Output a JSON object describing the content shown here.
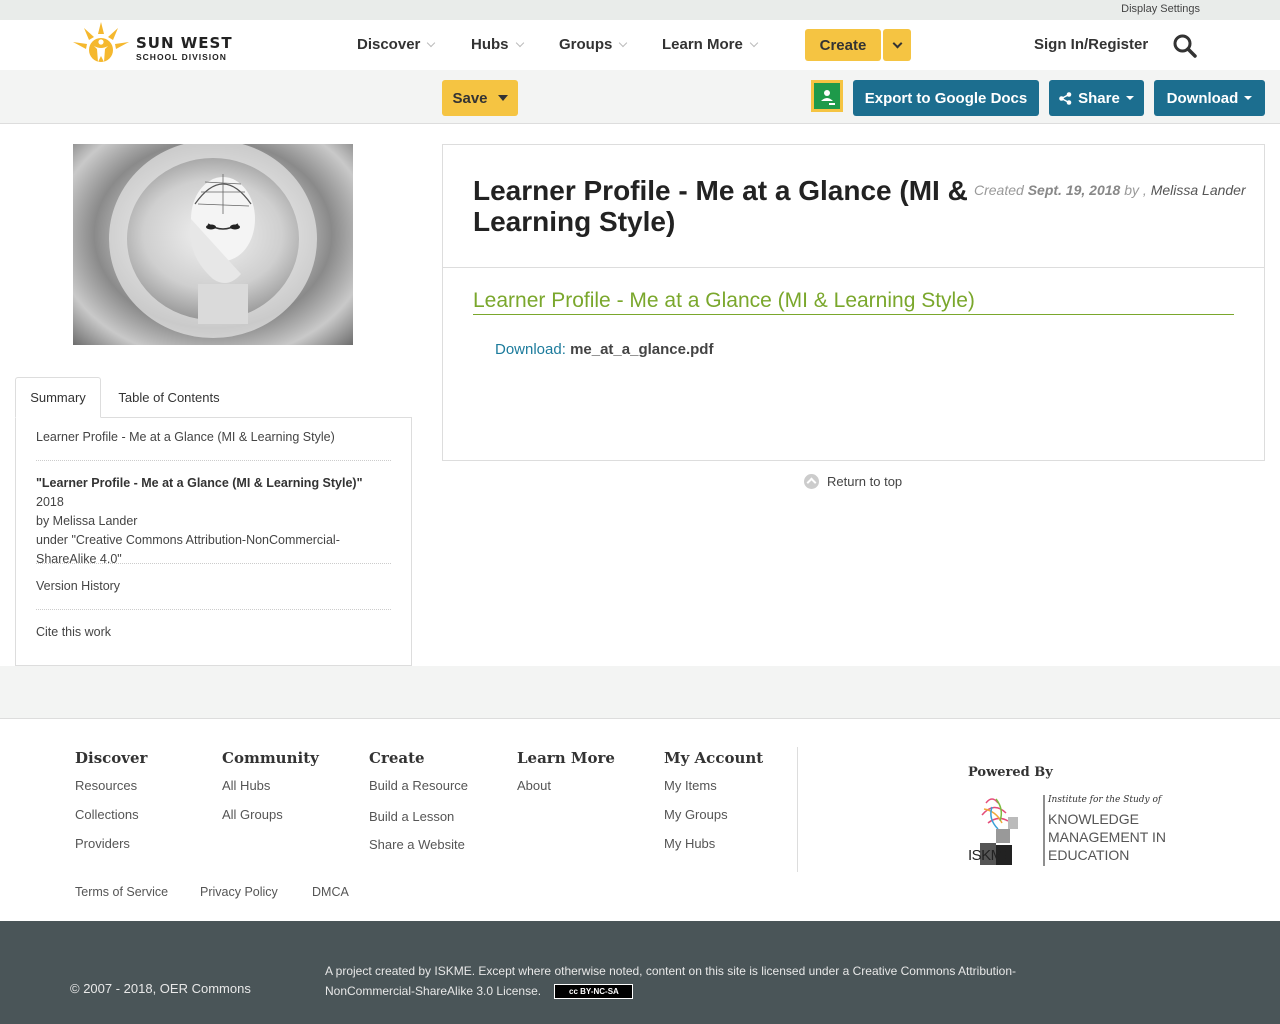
{
  "topbar": {
    "display_settings": "Display Settings"
  },
  "brand": {
    "name_line1": "SUN WEST",
    "name_line2": "SCHOOL DIVISION"
  },
  "nav": {
    "items": [
      {
        "label": "Discover"
      },
      {
        "label": "Hubs"
      },
      {
        "label": "Groups"
      },
      {
        "label": "Learn More"
      }
    ],
    "create": "Create",
    "signin": "Sign In/Register"
  },
  "toolbar": {
    "save": "Save",
    "export": "Export to Google Docs",
    "share": "Share",
    "download": "Download"
  },
  "sidebar": {
    "tabs": [
      "Summary",
      "Table of Contents"
    ],
    "summary_title": "Learner Profile - Me at a Glance (MI & Learning Style)",
    "attribution": {
      "work": "\"Learner Profile - Me at a Glance (MI & Learning Style)\"",
      "year": "2018",
      "by_line": "by Melissa Lander",
      "license_line": "under \"Creative Commons Attribution-NonCommercial-ShareAlike 4.0\""
    },
    "version_history": "Version History",
    "cite": "Cite this work"
  },
  "resource": {
    "title": "Learner Profile - Me at a Glance (MI & Learning Style)",
    "created_label": "Created",
    "created_date": "Sept. 19, 2018",
    "by": "by ,",
    "author": "Melissa Lander",
    "doc_link": "Learner Profile - Me at a Glance (MI & Learning Style)",
    "download_label": "Download:",
    "file_name": "me_at_a_glance.pdf",
    "return_top": "Return to top"
  },
  "footer": {
    "columns": [
      {
        "title": "Discover",
        "links": [
          "Resources",
          "Collections",
          "Providers"
        ]
      },
      {
        "title": "Community",
        "links": [
          "All Hubs",
          "All Groups"
        ]
      },
      {
        "title": "Create",
        "links": [
          "Build a Resource",
          "Build a Lesson",
          "Share a Website"
        ]
      },
      {
        "title": "Learn More",
        "links": [
          "About"
        ]
      },
      {
        "title": "My Account",
        "links": [
          "My Items",
          "My Groups",
          "My Hubs"
        ]
      }
    ],
    "powered_by": "Powered By",
    "iskme": {
      "tagline": "Institute for the Study of",
      "line1": "KNOWLEDGE",
      "line2": "MANAGEMENT IN",
      "line3": "EDUCATION",
      "abbr": "ISKME"
    },
    "legal": [
      "Terms of Service",
      "Privacy Policy",
      "DMCA"
    ],
    "copyright": "© 2007 - 2018, OER Commons",
    "license_text": "A project created by ISKME. Except where otherwise noted, content on this site is licensed under a Creative Commons Attribution-NonCommercial-ShareAlike 3.0 License.",
    "cc_badge": "cc BY-NC-SA"
  },
  "colors": {
    "accent_yellow": "#f5c442",
    "button_blue": "#1c6e8f",
    "link_green": "#7aa72c",
    "footer_dark": "#4a5558"
  }
}
